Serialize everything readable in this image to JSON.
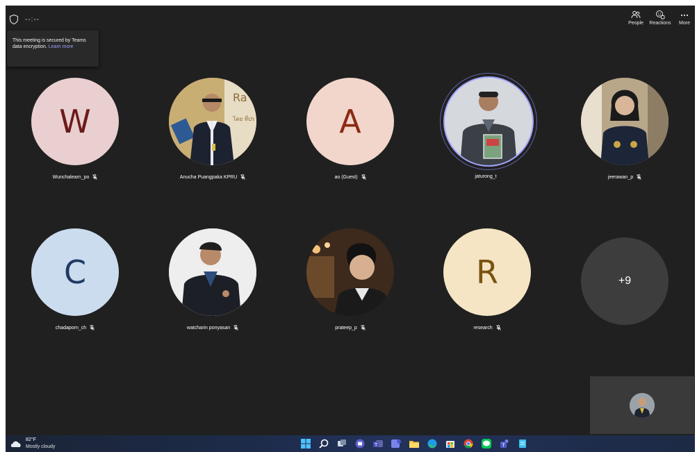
{
  "topbar": {
    "timer": "--:--",
    "buttons": [
      {
        "label": "People",
        "icon": "people-icon"
      },
      {
        "label": "Reactions",
        "icon": "reactions-icon"
      },
      {
        "label": "More",
        "icon": "more-icon"
      }
    ]
  },
  "tooltip": {
    "text": "This meeting is secured by Teams data encryption.",
    "link": "Learn more"
  },
  "participants": [
    {
      "name": "Wunchalearn_po",
      "initial": "W",
      "bg": "#e9cfcf",
      "fg": "#6b1a1a",
      "muted": true
    },
    {
      "name": "Anucha Puangpaka KPRU",
      "photo": true,
      "muted": true
    },
    {
      "name": "ao (Guest)",
      "initial": "A",
      "bg": "#f2d6cc",
      "fg": "#8a2a12",
      "muted": true
    },
    {
      "name": "jaturong_t",
      "photo": true,
      "muted": false,
      "speaking": true
    },
    {
      "name": "jeerawan_p",
      "photo": true,
      "muted": true
    },
    {
      "name": "chadaporn_ch",
      "initial": "C",
      "bg": "#cbdcef",
      "fg": "#1f3a63",
      "muted": true
    },
    {
      "name": "watcharin ponyasan",
      "photo": true,
      "muted": true
    },
    {
      "name": "prateep_p",
      "photo": true,
      "muted": true
    },
    {
      "name": "research",
      "initial": "R",
      "bg": "#f5e5c5",
      "fg": "#7a5410",
      "muted": true
    }
  ],
  "overflow": {
    "label": "+9"
  },
  "weather": {
    "temp": "82°F",
    "condition": "Mostly cloudy"
  },
  "taskbar_icons": [
    "windows-start-icon",
    "search-icon",
    "task-view-icon",
    "chat-icon",
    "teams-icon",
    "teams-classic-icon",
    "file-explorer-icon",
    "edge-icon",
    "store-icon",
    "chrome-icon",
    "line-icon",
    "teams-meeting-icon",
    "notepad-icon"
  ]
}
